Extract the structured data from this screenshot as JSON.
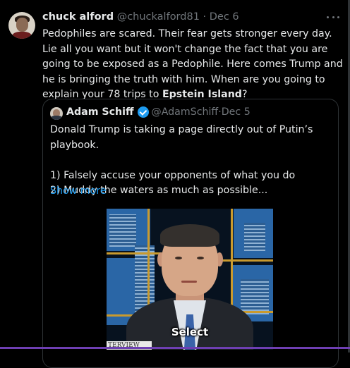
{
  "tweet": {
    "author_name": "chuck alford",
    "author_handle": "@chuckalford81",
    "sep": " · ",
    "date": "Dec 6",
    "text_before": "Pedophiles are scared. Their fear gets stronger every day. Lie all you want but it won't change the fact that you are going to be exposed as a Pedophile. Here comes Trump and he is bringing the truth with him. When are you going to explain your 78 trips to ",
    "text_bold": "Epstein Island",
    "text_after": "?"
  },
  "quote": {
    "author_name": "Adam Schiff",
    "author_handle": "@AdamSchiff",
    "sep": " · ",
    "date": "Dec 5",
    "line1": "Donald Trump is taking a page directly out of Putin’s playbook.",
    "line2": "1) Falsely accuse your opponents of what you do",
    "line3": "2) Muddy the waters as much as possible...",
    "show_more": "Show more",
    "video_caption": "Select",
    "lower_third": "TERVIEW"
  },
  "icons": {
    "more": "more-horizontal-icon",
    "verified": "verified-badge-icon"
  },
  "colors": {
    "background": "#000000",
    "text": "#e7e9ea",
    "muted": "#71767b",
    "link": "#1d9bf0",
    "border": "#2f3336"
  }
}
